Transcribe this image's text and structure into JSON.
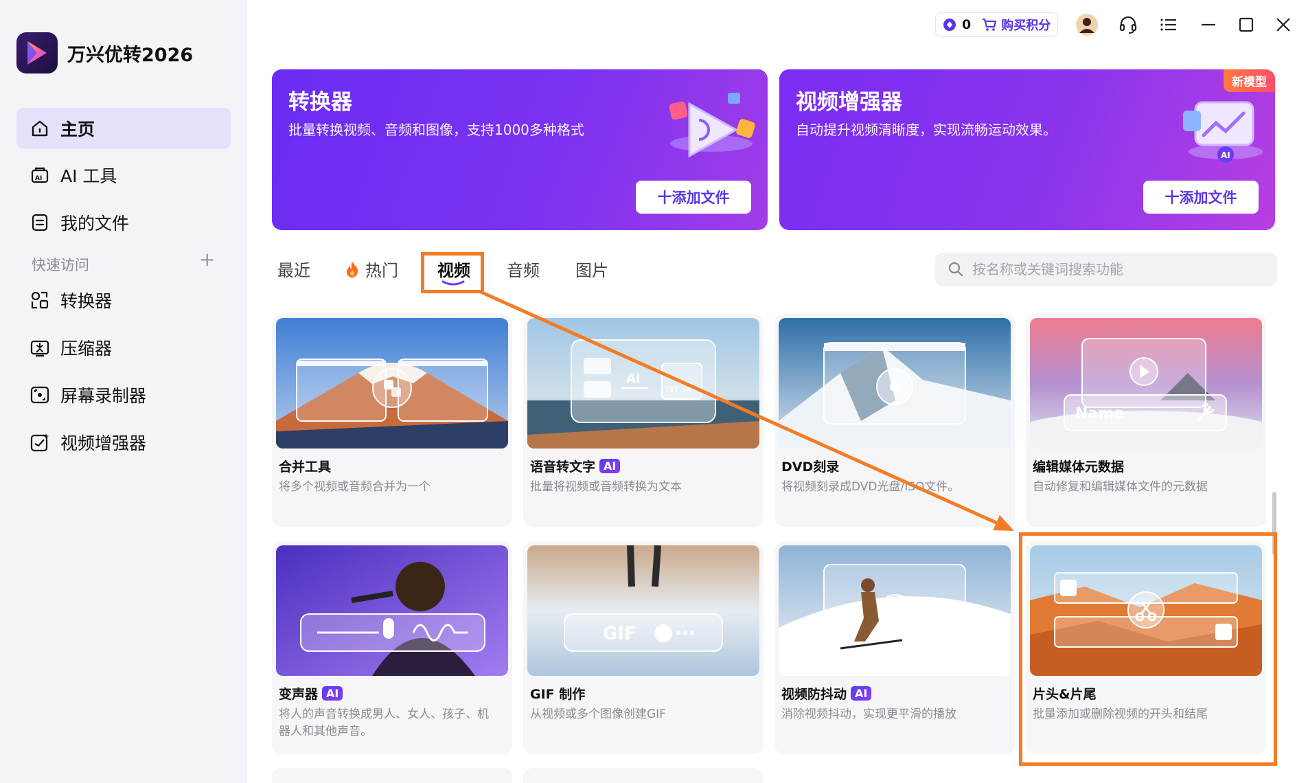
{
  "app": {
    "name": "万兴优转2026"
  },
  "sidebar": {
    "items": [
      {
        "label": "主页",
        "icon": "home-icon",
        "active": true
      },
      {
        "label": "AI 工具",
        "icon": "ai-tools-icon",
        "active": false
      },
      {
        "label": "我的文件",
        "icon": "file-icon",
        "active": false
      }
    ],
    "quick_access": {
      "title": "快速访问",
      "items": [
        {
          "label": "转换器",
          "icon": "converter-icon"
        },
        {
          "label": "压缩器",
          "icon": "compressor-icon"
        },
        {
          "label": "屏幕录制器",
          "icon": "screen-recorder-icon"
        },
        {
          "label": "视频增强器",
          "icon": "video-enhancer-icon"
        }
      ]
    }
  },
  "topbar": {
    "points": "0",
    "buy_label": "购买积分"
  },
  "banners": [
    {
      "title": "转换器",
      "desc": "批量转换视频、音频和图像，支持1000多种格式",
      "button": "十添加文件"
    },
    {
      "title": "视频增强器",
      "desc": "自动提升视频清晰度，实现流畅运动效果。",
      "button": "十添加文件",
      "tag": "新模型"
    }
  ],
  "tabs": [
    {
      "label": "最近",
      "active": false
    },
    {
      "label": "热门",
      "active": false,
      "icon": "fire-icon"
    },
    {
      "label": "视频",
      "active": true
    },
    {
      "label": "音频",
      "active": false
    },
    {
      "label": "图片",
      "active": false
    }
  ],
  "search": {
    "placeholder": "按名称或关键词搜索功能"
  },
  "cards": [
    {
      "title": "合并工具",
      "desc": "将多个视频或音频合并为一个",
      "ai": false
    },
    {
      "title": "语音转文字",
      "desc": "批量将视频或音频转换为文本",
      "ai": true
    },
    {
      "title": "DVD刻录",
      "desc": "将视频刻录成DVD光盘/ISO文件。",
      "ai": false
    },
    {
      "title": "编辑媒体元数据",
      "desc": "自动修复和编辑媒体文件的元数据",
      "ai": false
    },
    {
      "title": "变声器",
      "desc": "将人的声音转换成男人、女人、孩子、机器人和其他声音。",
      "ai": true
    },
    {
      "title": "GIF 制作",
      "desc": "从视频或多个图像创建GIF",
      "ai": false
    },
    {
      "title": "视频防抖动",
      "desc": "消除视频抖动，实现更平滑的播放",
      "ai": true
    },
    {
      "title": "片头&片尾",
      "desc": "批量添加或删除视频的开头和结尾",
      "ai": false
    }
  ],
  "thumb_texts": {
    "stt": "AI",
    "stt_doc": "TXT SRT",
    "metadata_name": "Name",
    "gif": "GIF"
  },
  "badges": {
    "ai": "AI"
  },
  "colors": {
    "accent": "#5a35e8",
    "annotation": "#f47c25",
    "active_nav": "#e6e0fb"
  }
}
